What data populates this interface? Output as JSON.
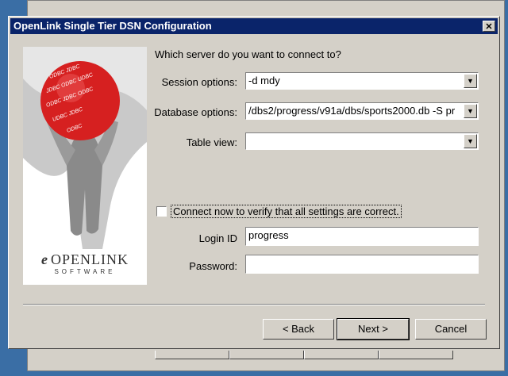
{
  "window": {
    "title": "OpenLink Single Tier DSN Configuration",
    "close_glyph": "✕"
  },
  "logo": {
    "company": "OPENLINK",
    "tagline": "SOFTWARE",
    "mark_glyph": "e"
  },
  "form": {
    "prompt": "Which server do you want to connect to?",
    "session_label": "Session options:",
    "session_value": "-d mdy",
    "database_label": "Database options:",
    "database_value": "/dbs2/progress/v91a/dbs/sports2000.db -S pr",
    "table_label": "Table view:",
    "table_value": "",
    "connect_label": "Connect now to verify that all settings are correct.",
    "login_label": "Login ID",
    "login_value": "progress",
    "password_label": "Password:",
    "password_value": ""
  },
  "buttons": {
    "back": "< Back",
    "next": "Next >",
    "cancel": "Cancel"
  },
  "icons": {
    "dropdown": "chevron-down-icon",
    "close": "close-icon"
  },
  "colors": {
    "titlebar": "#0a246a",
    "face": "#d4d0c8",
    "desktop": "#3a6ea5"
  }
}
